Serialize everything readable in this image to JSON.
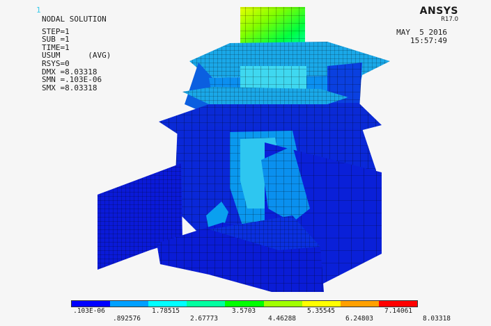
{
  "window_number": "1",
  "result": {
    "title": "NODAL SOLUTION",
    "step": "STEP=1",
    "sub": "SUB =1",
    "time": "TIME=1",
    "usum": "USUM      (AVG)",
    "rsys": "RSYS=0",
    "dmx": "DMX =8.03318",
    "smn": "SMN =.103E-06",
    "smx": "SMX =8.03318"
  },
  "logo": {
    "name": "ANSYS",
    "version": "R17.0"
  },
  "date": "MAY  5 2016",
  "time_of_day": "15:57:49",
  "legend": {
    "colors": [
      "#0000ff",
      "#00a0ff",
      "#00ffff",
      "#00ffa0",
      "#00ff00",
      "#a0ff00",
      "#ffff00",
      "#ffa000",
      "#ff0000"
    ],
    "labels_top": [
      ".103E-06",
      "1.78515",
      "3.5703",
      "5.35545",
      "7.14061"
    ],
    "labels_bottom": [
      ".892576",
      "2.67773",
      "4.46288",
      "6.24803",
      "8.03318"
    ]
  }
}
